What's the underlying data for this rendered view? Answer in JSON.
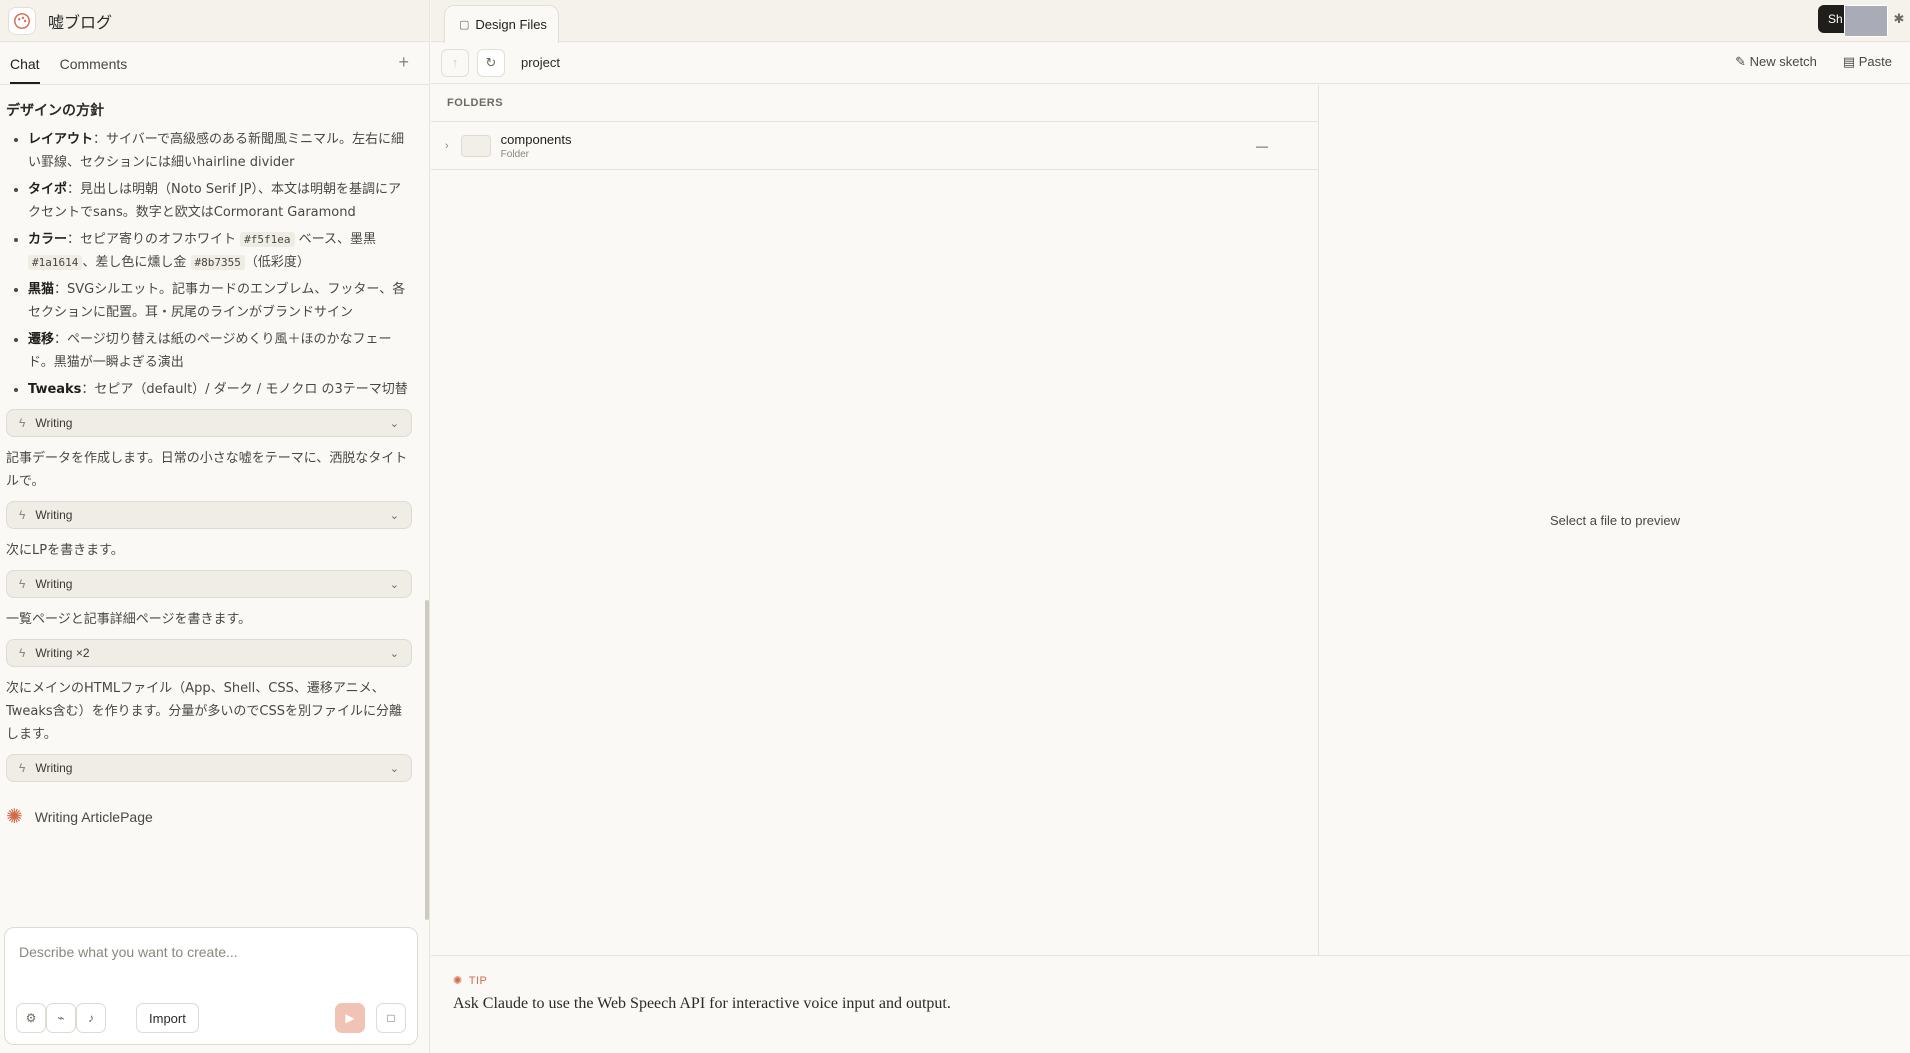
{
  "app": {
    "title": "嘘ブログ"
  },
  "left_tabs": [
    {
      "label": "Chat"
    },
    {
      "label": "Comments"
    }
  ],
  "chat": {
    "heading": "デザインの方針",
    "bullets": [
      {
        "title": "レイアウト",
        "text": "：サイバーで高級感のある新聞風ミニマル。左右に細い罫線、セクションには細いhairline divider"
      },
      {
        "title": "タイポ",
        "text": "：見出しは明朝（Noto Serif JP）、本文は明朝を基調にアクセントでsans。数字と欧文はCormorant Garamond"
      },
      {
        "title": "カラー",
        "text_a": "：セピア寄りのオフホワイト ",
        "code_a": "#f5f1ea",
        "text_b": " ベース、墨黒 ",
        "code_b": "#1a1614",
        "text_c": "、差し色に燻し金 ",
        "code_c": "#8b7355",
        "text_d": "（低彩度）"
      },
      {
        "title": "黒猫",
        "text": "：SVGシルエット。記事カードのエンブレム、フッター、各セクションに配置。耳・尻尾のラインがブランドサイン"
      },
      {
        "title": "遷移",
        "text": "：ページ切り替えは紙のページめくり風＋ほのかなフェード。黒猫が一瞬よぎる演出"
      },
      {
        "title": "Tweaks",
        "text": "：セピア（default）/ ダーク / モノクロ の3テーマ切替"
      }
    ],
    "tools": [
      {
        "label": "Writing"
      },
      {
        "label": "Writing"
      },
      {
        "label": "Writing"
      },
      {
        "label": "Writing ×2"
      },
      {
        "label": "Writing"
      }
    ],
    "messages": [
      "記事データを作成します。日常の小さな嘘をテーマに、洒脱なタイトルで。",
      "次にLPを書きます。",
      "一覧ページと記事詳細ページを書きます。",
      "次にメインのHTMLファイル（App、Shell、CSS、遷移アニメ、Tweaks含む）を作ります。分量が多いのでCSSを別ファイルに分離します。"
    ],
    "status": "Writing ArticlePage"
  },
  "composer": {
    "placeholder": "Describe what you want to create...",
    "import_label": "Import"
  },
  "right": {
    "file_tab": "Design Files",
    "share_label": "Sh",
    "path": "project",
    "new_sketch": "New sketch",
    "paste": "Paste",
    "folders_header": "FOLDERS",
    "folders": [
      {
        "name": "components",
        "type": "Folder",
        "modified": "—"
      }
    ],
    "preview_empty": "Select a file to preview",
    "tip_label": "TIP",
    "tip_text": "Ask Claude to use the Web Speech API for interactive voice input and output."
  },
  "colors": {
    "accent": "#d46a4a",
    "background": "#faf9f5",
    "dark": "#1f1e1b"
  },
  "icons": [
    "palette-icon",
    "plus-icon",
    "bolt-icon",
    "chevron-down-icon",
    "spark-icon",
    "settings-icon",
    "paperclip-icon",
    "mic-icon",
    "send-icon",
    "stop-icon",
    "file-icon",
    "gear-icon",
    "arrow-up-icon",
    "refresh-icon",
    "pen-icon",
    "clipboard-icon",
    "chevron-right-icon",
    "folder-icon"
  ]
}
